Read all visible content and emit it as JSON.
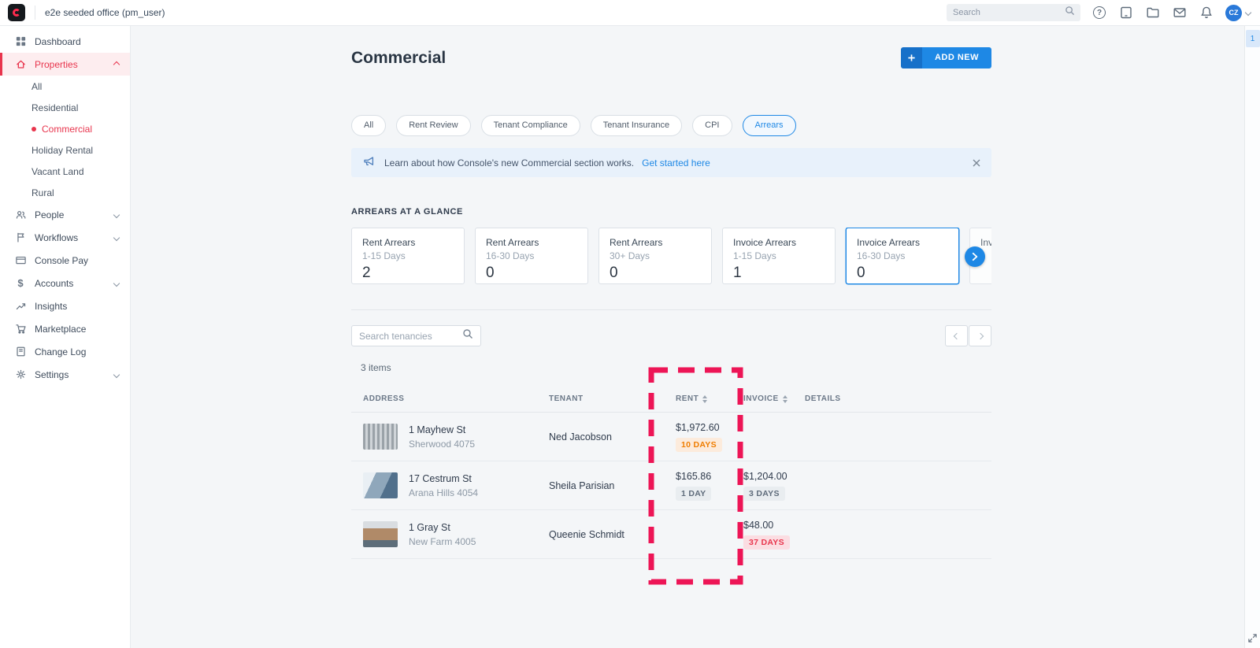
{
  "topbar": {
    "workspace": "e2e seeded office (pm_user)",
    "search_placeholder": "Search",
    "avatar_initials": "CZ"
  },
  "sidebar": {
    "dashboard": "Dashboard",
    "properties": "Properties",
    "properties_sub": {
      "all": "All",
      "residential": "Residential",
      "commercial": "Commercial",
      "holiday_rental": "Holiday Rental",
      "vacant_land": "Vacant Land",
      "rural": "Rural"
    },
    "people": "People",
    "workflows": "Workflows",
    "console_pay": "Console Pay",
    "accounts": "Accounts",
    "insights": "Insights",
    "marketplace": "Marketplace",
    "change_log": "Change Log",
    "settings": "Settings"
  },
  "page": {
    "title": "Commercial",
    "add_new_label": "ADD NEW"
  },
  "filters": {
    "all": "All",
    "rent_review": "Rent Review",
    "tenant_compliance": "Tenant Compliance",
    "tenant_insurance": "Tenant Insurance",
    "cpi": "CPI",
    "arrears": "Arrears"
  },
  "banner": {
    "text": "Learn about how Console's new Commercial section works.",
    "link": "Get started here"
  },
  "glance": {
    "heading": "ARREARS AT A GLANCE",
    "cards": [
      {
        "title": "Rent Arrears",
        "subtitle": "1-15 Days",
        "value": "2"
      },
      {
        "title": "Rent Arrears",
        "subtitle": "16-30 Days",
        "value": "0"
      },
      {
        "title": "Rent Arrears",
        "subtitle": "30+ Days",
        "value": "0"
      },
      {
        "title": "Invoice Arrears",
        "subtitle": "1-15 Days",
        "value": "1"
      },
      {
        "title": "Invoice Arrears",
        "subtitle": "16-30 Days",
        "value": "0"
      },
      {
        "title": "Inv",
        "subtitle": "",
        "value": ""
      }
    ]
  },
  "toolbar": {
    "search_placeholder": "Search tenancies",
    "items_count": "3 items"
  },
  "table": {
    "columns": {
      "address": "ADDRESS",
      "tenant": "TENANT",
      "rent": "RENT",
      "invoice": "INVOICE",
      "details": "DETAILS"
    },
    "rows": [
      {
        "address": "1 Mayhew St",
        "suburb": "Sherwood 4075",
        "tenant": "Ned Jacobson",
        "rent_amount": "$1,972.60",
        "rent_badge": "10 DAYS",
        "invoice_amount": "",
        "invoice_badge": ""
      },
      {
        "address": "17 Cestrum St",
        "suburb": "Arana Hills 4054",
        "tenant": "Sheila Parisian",
        "rent_amount": "$165.86",
        "rent_badge": "1 DAY",
        "invoice_amount": "$1,204.00",
        "invoice_badge": "3 DAYS"
      },
      {
        "address": "1 Gray St",
        "suburb": "New Farm 4005",
        "tenant": "Queenie Schmidt",
        "rent_amount": "",
        "rent_badge": "",
        "invoice_amount": "$48.00",
        "invoice_badge": "37 DAYS"
      }
    ]
  },
  "rail": {
    "page_indicator": "1"
  },
  "colors": {
    "brand_red": "#e8354d",
    "accent_blue": "#1e88e5",
    "annotation_pink": "#ed1556",
    "badge_orange": "#ef7d00",
    "badge_red": "#e8354d"
  }
}
